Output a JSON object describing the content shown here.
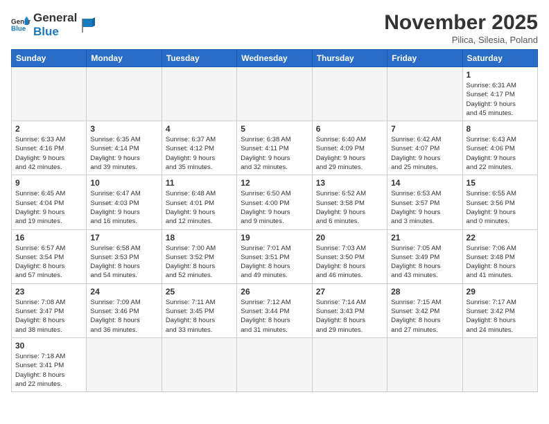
{
  "logo": {
    "line1": "General",
    "line2": "Blue"
  },
  "header": {
    "month_year": "November 2025",
    "location": "Pilica, Silesia, Poland"
  },
  "weekdays": [
    "Sunday",
    "Monday",
    "Tuesday",
    "Wednesday",
    "Thursday",
    "Friday",
    "Saturday"
  ],
  "weeks": [
    [
      {
        "day": "",
        "info": ""
      },
      {
        "day": "",
        "info": ""
      },
      {
        "day": "",
        "info": ""
      },
      {
        "day": "",
        "info": ""
      },
      {
        "day": "",
        "info": ""
      },
      {
        "day": "",
        "info": ""
      },
      {
        "day": "1",
        "info": "Sunrise: 6:31 AM\nSunset: 4:17 PM\nDaylight: 9 hours\nand 45 minutes."
      }
    ],
    [
      {
        "day": "2",
        "info": "Sunrise: 6:33 AM\nSunset: 4:16 PM\nDaylight: 9 hours\nand 42 minutes."
      },
      {
        "day": "3",
        "info": "Sunrise: 6:35 AM\nSunset: 4:14 PM\nDaylight: 9 hours\nand 39 minutes."
      },
      {
        "day": "4",
        "info": "Sunrise: 6:37 AM\nSunset: 4:12 PM\nDaylight: 9 hours\nand 35 minutes."
      },
      {
        "day": "5",
        "info": "Sunrise: 6:38 AM\nSunset: 4:11 PM\nDaylight: 9 hours\nand 32 minutes."
      },
      {
        "day": "6",
        "info": "Sunrise: 6:40 AM\nSunset: 4:09 PM\nDaylight: 9 hours\nand 29 minutes."
      },
      {
        "day": "7",
        "info": "Sunrise: 6:42 AM\nSunset: 4:07 PM\nDaylight: 9 hours\nand 25 minutes."
      },
      {
        "day": "8",
        "info": "Sunrise: 6:43 AM\nSunset: 4:06 PM\nDaylight: 9 hours\nand 22 minutes."
      }
    ],
    [
      {
        "day": "9",
        "info": "Sunrise: 6:45 AM\nSunset: 4:04 PM\nDaylight: 9 hours\nand 19 minutes."
      },
      {
        "day": "10",
        "info": "Sunrise: 6:47 AM\nSunset: 4:03 PM\nDaylight: 9 hours\nand 16 minutes."
      },
      {
        "day": "11",
        "info": "Sunrise: 6:48 AM\nSunset: 4:01 PM\nDaylight: 9 hours\nand 12 minutes."
      },
      {
        "day": "12",
        "info": "Sunrise: 6:50 AM\nSunset: 4:00 PM\nDaylight: 9 hours\nand 9 minutes."
      },
      {
        "day": "13",
        "info": "Sunrise: 6:52 AM\nSunset: 3:58 PM\nDaylight: 9 hours\nand 6 minutes."
      },
      {
        "day": "14",
        "info": "Sunrise: 6:53 AM\nSunset: 3:57 PM\nDaylight: 9 hours\nand 3 minutes."
      },
      {
        "day": "15",
        "info": "Sunrise: 6:55 AM\nSunset: 3:56 PM\nDaylight: 9 hours\nand 0 minutes."
      }
    ],
    [
      {
        "day": "16",
        "info": "Sunrise: 6:57 AM\nSunset: 3:54 PM\nDaylight: 8 hours\nand 57 minutes."
      },
      {
        "day": "17",
        "info": "Sunrise: 6:58 AM\nSunset: 3:53 PM\nDaylight: 8 hours\nand 54 minutes."
      },
      {
        "day": "18",
        "info": "Sunrise: 7:00 AM\nSunset: 3:52 PM\nDaylight: 8 hours\nand 52 minutes."
      },
      {
        "day": "19",
        "info": "Sunrise: 7:01 AM\nSunset: 3:51 PM\nDaylight: 8 hours\nand 49 minutes."
      },
      {
        "day": "20",
        "info": "Sunrise: 7:03 AM\nSunset: 3:50 PM\nDaylight: 8 hours\nand 46 minutes."
      },
      {
        "day": "21",
        "info": "Sunrise: 7:05 AM\nSunset: 3:49 PM\nDaylight: 8 hours\nand 43 minutes."
      },
      {
        "day": "22",
        "info": "Sunrise: 7:06 AM\nSunset: 3:48 PM\nDaylight: 8 hours\nand 41 minutes."
      }
    ],
    [
      {
        "day": "23",
        "info": "Sunrise: 7:08 AM\nSunset: 3:47 PM\nDaylight: 8 hours\nand 38 minutes."
      },
      {
        "day": "24",
        "info": "Sunrise: 7:09 AM\nSunset: 3:46 PM\nDaylight: 8 hours\nand 36 minutes."
      },
      {
        "day": "25",
        "info": "Sunrise: 7:11 AM\nSunset: 3:45 PM\nDaylight: 8 hours\nand 33 minutes."
      },
      {
        "day": "26",
        "info": "Sunrise: 7:12 AM\nSunset: 3:44 PM\nDaylight: 8 hours\nand 31 minutes."
      },
      {
        "day": "27",
        "info": "Sunrise: 7:14 AM\nSunset: 3:43 PM\nDaylight: 8 hours\nand 29 minutes."
      },
      {
        "day": "28",
        "info": "Sunrise: 7:15 AM\nSunset: 3:42 PM\nDaylight: 8 hours\nand 27 minutes."
      },
      {
        "day": "29",
        "info": "Sunrise: 7:17 AM\nSunset: 3:42 PM\nDaylight: 8 hours\nand 24 minutes."
      }
    ],
    [
      {
        "day": "30",
        "info": "Sunrise: 7:18 AM\nSunset: 3:41 PM\nDaylight: 8 hours\nand 22 minutes."
      },
      {
        "day": "",
        "info": ""
      },
      {
        "day": "",
        "info": ""
      },
      {
        "day": "",
        "info": ""
      },
      {
        "day": "",
        "info": ""
      },
      {
        "day": "",
        "info": ""
      },
      {
        "day": "",
        "info": ""
      }
    ]
  ]
}
